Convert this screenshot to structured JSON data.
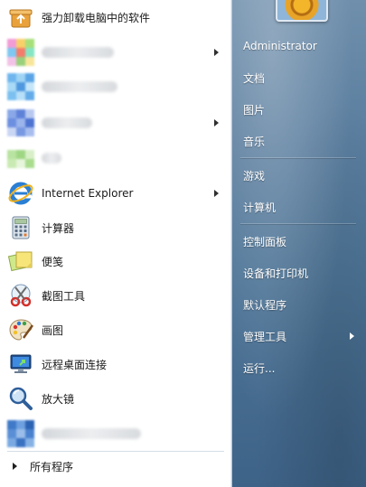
{
  "programs": [
    {
      "label": "强力卸载电脑中的软件",
      "icon": "uninstall-box-icon",
      "submenu": false
    },
    {
      "label": "",
      "icon": "blurred-app-icon",
      "submenu": true
    },
    {
      "label": "",
      "icon": "blurred-app-icon",
      "submenu": false
    },
    {
      "label": "",
      "icon": "blurred-app-icon",
      "submenu": true
    },
    {
      "label": "",
      "icon": "blurred-app-icon",
      "submenu": false
    },
    {
      "label": "Internet Explorer",
      "icon": "internet-explorer-icon",
      "submenu": true
    },
    {
      "label": "计算器",
      "icon": "calculator-icon",
      "submenu": false
    },
    {
      "label": "便笺",
      "icon": "sticky-notes-icon",
      "submenu": false
    },
    {
      "label": "截图工具",
      "icon": "snipping-tool-icon",
      "submenu": false
    },
    {
      "label": "画图",
      "icon": "paint-palette-icon",
      "submenu": false
    },
    {
      "label": "远程桌面连接",
      "icon": "remote-desktop-icon",
      "submenu": false
    },
    {
      "label": "放大镜",
      "icon": "magnifier-icon",
      "submenu": false
    },
    {
      "label": "",
      "icon": "blurred-app-icon",
      "submenu": false
    }
  ],
  "all_programs": "所有程序",
  "right_pane": {
    "user": "Administrator",
    "documents": "文档",
    "pictures": "图片",
    "music": "音乐",
    "games": "游戏",
    "computer": "计算机",
    "control_panel": "控制面板",
    "devices_printers": "设备和打印机",
    "default_programs": "默认程序",
    "admin_tools": "管理工具",
    "run": "运行..."
  },
  "colors": {
    "left_bg": "#ffffff",
    "right_bg": "#4e7597",
    "text_dark": "#1a1a1a",
    "text_light": "#ffffff"
  }
}
